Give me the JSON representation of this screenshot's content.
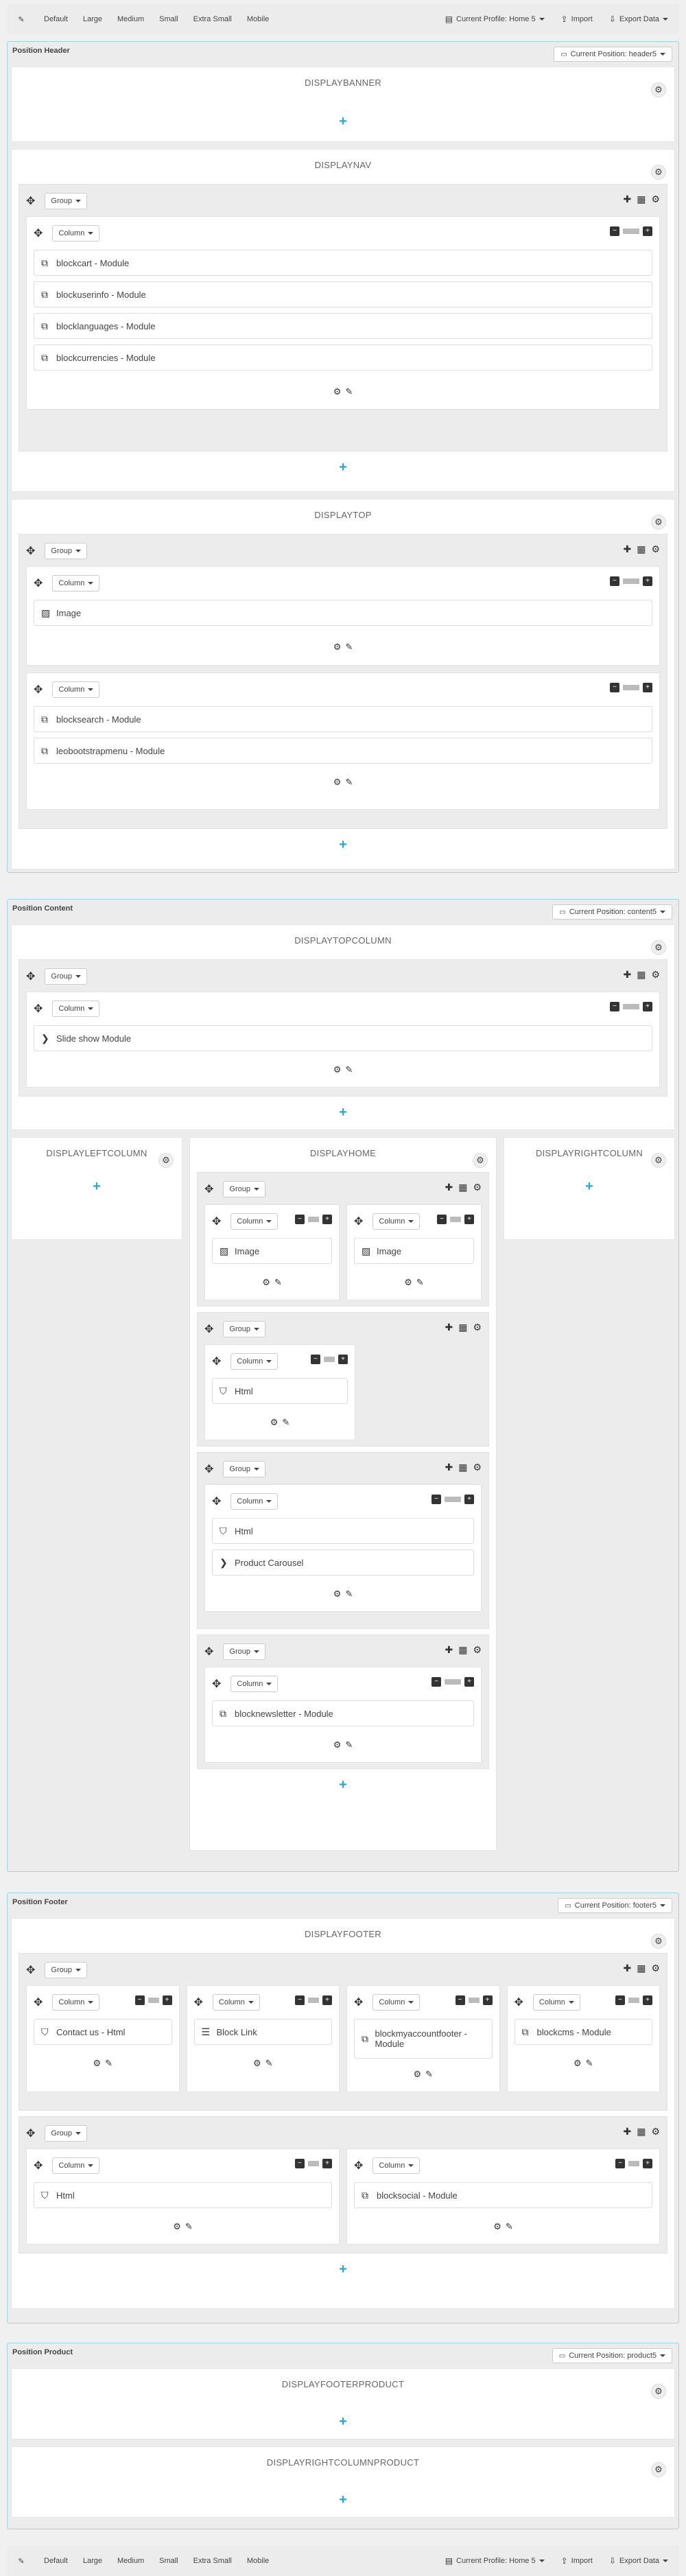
{
  "toolbar": {
    "devices": [
      "Default",
      "Large",
      "Medium",
      "Small",
      "Extra Small",
      "Mobile"
    ],
    "profile_label": "Current Profile: Home 5",
    "import_label": "Import",
    "export_label": "Export Data"
  },
  "labels": {
    "group": "Group",
    "column": "Column"
  },
  "header": {
    "title": "Position Header",
    "current": "Current Position: header5",
    "hooks": {
      "banner": "DISPLAYBANNER",
      "nav": "DISPLAYNAV",
      "top": "DISPLAYTOP"
    },
    "nav_widgets": [
      "blockcart - Module",
      "blockuserinfo - Module",
      "blocklanguages - Module",
      "blockcurrencies - Module"
    ],
    "top_col1_widgets": [
      "Image"
    ],
    "top_col2_widgets": [
      "blocksearch - Module",
      "leobootstrapmenu - Module"
    ]
  },
  "content": {
    "title": "Position Content",
    "current": "Current Position: content5",
    "hooks": {
      "topcolumn": "DISPLAYTOPCOLUMN",
      "left": "DISPLAYLEFTCOLUMN",
      "home": "DISPLAYHOME",
      "right": "DISPLAYRIGHTCOLUMN"
    },
    "slideshow": "Slide show Module",
    "home_g1_c1": "Image",
    "home_g1_c2": "Image",
    "home_g2": "Html",
    "home_g3": [
      "Html",
      "Product Carousel"
    ],
    "home_g4": "blocknewsletter - Module"
  },
  "footer": {
    "title": "Position Footer",
    "current": "Current Position: footer5",
    "hook": "DISPLAYFOOTER",
    "g1": [
      "Contact us - Html",
      "Block Link",
      "blockmyaccountfooter - Module",
      "blockcms - Module"
    ],
    "g2": [
      "Html",
      "blocksocial - Module"
    ]
  },
  "product": {
    "title": "Position Product",
    "current": "Current Position: product5",
    "hooks": [
      "DISPLAYFOOTERPRODUCT",
      "DISPLAYRIGHTCOLUMNPRODUCT"
    ]
  }
}
